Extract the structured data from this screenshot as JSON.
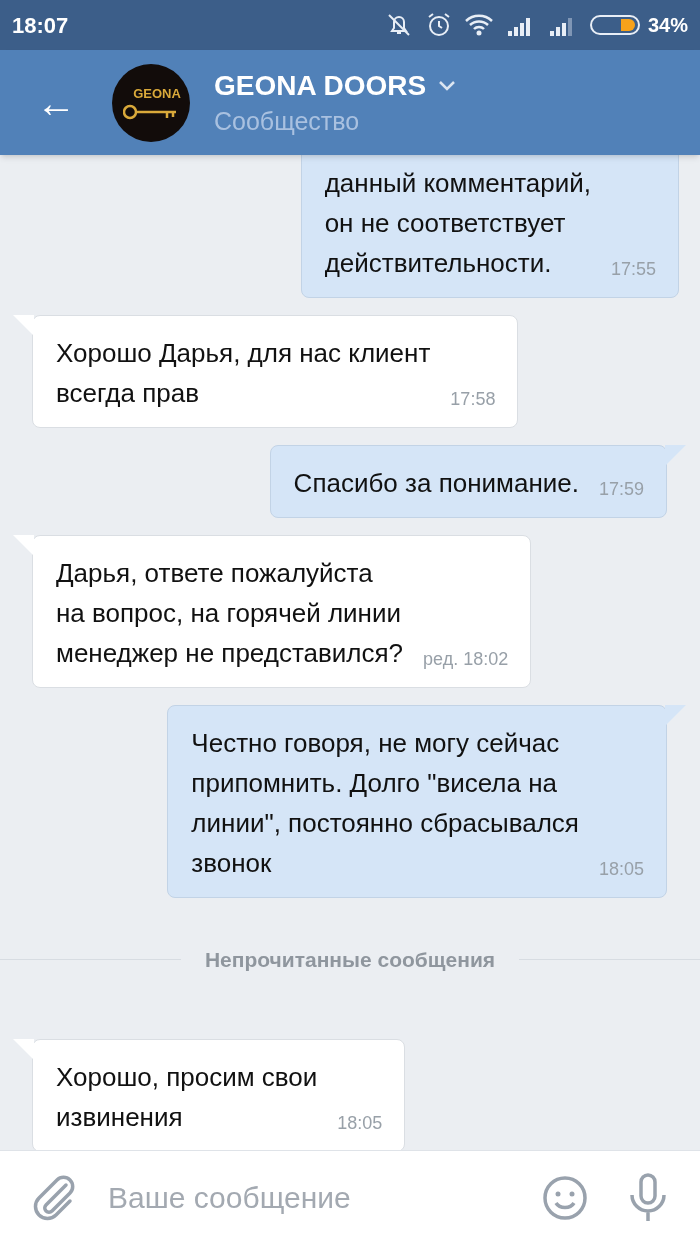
{
  "status_bar": {
    "time": "18:07",
    "battery": "34%"
  },
  "header": {
    "back": "←",
    "avatar_text": "GEONA",
    "title": "GEONA DOORS",
    "subtitle": "Сообщество"
  },
  "messages": [
    {
      "kind": "message",
      "outgoing": true,
      "text": "данный комментарий,\nон не соответствует\nдействительности.",
      "time": "17:55"
    },
    {
      "kind": "message",
      "outgoing": false,
      "text": "Хорошо Дарья, для нас клиент\nвсегда прав",
      "time": "17:58"
    },
    {
      "kind": "message",
      "outgoing": true,
      "text": "Спасибо за понимание.",
      "time": "17:59"
    },
    {
      "kind": "message",
      "outgoing": false,
      "text": "Дарья, ответе пожалуйста\nна вопрос, на горячей линии\nменеджер не представился?",
      "time": "ред. 18:02"
    },
    {
      "kind": "message",
      "outgoing": true,
      "text": "Честно говоря, не могу сейчас\nприпомнить. Долго \"висела на\nлинии\", постоянно сбрасывался\nзвонок",
      "time": "18:05"
    },
    {
      "kind": "divider",
      "text": "Непрочитанные сообщения"
    },
    {
      "kind": "message",
      "outgoing": false,
      "text": "Хорошо, просим свои\nизвинения",
      "time": "18:05"
    }
  ],
  "composer": {
    "placeholder": "Ваше сообщение"
  }
}
